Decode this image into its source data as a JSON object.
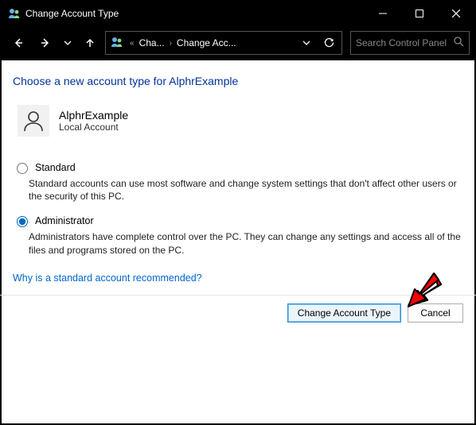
{
  "window": {
    "title": "Change Account Type"
  },
  "breadcrumb": {
    "crumb1": "Cha...",
    "crumb2": "Change Acc...",
    "prefix": "«"
  },
  "search": {
    "placeholder": "Search Control Panel"
  },
  "heading": "Choose a new account type for AlphrExample",
  "user": {
    "name": "AlphrExample",
    "type": "Local Account"
  },
  "options": {
    "standard": {
      "label": "Standard",
      "desc": "Standard accounts can use most software and change system settings that don't affect other users or the security of this PC."
    },
    "admin": {
      "label": "Administrator",
      "desc": "Administrators have complete control over the PC. They can change any settings and access all of the files and programs stored on the PC."
    }
  },
  "help_link": "Why is a standard account recommended?",
  "buttons": {
    "primary": "Change Account Type",
    "cancel": "Cancel"
  }
}
